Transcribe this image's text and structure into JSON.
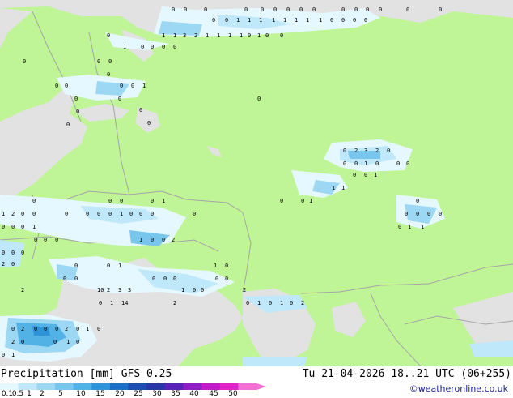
{
  "footer": {
    "title": "Precipitation [mm]",
    "model": "GFS 0.25",
    "valid_time": "Tu 21-04-2026 18..21 UTC (06+255)",
    "credit": "©weatheronline.co.uk"
  },
  "legend": {
    "labels": [
      "0.1",
      "0.5",
      "1",
      "2",
      "5",
      "10",
      "15",
      "20",
      "25",
      "30",
      "35",
      "40",
      "45",
      "50"
    ],
    "colors": [
      "#e6f8ff",
      "#bfe8fa",
      "#9cd8f4",
      "#78c6ee",
      "#52b1e5",
      "#2f93d8",
      "#1e6fc6",
      "#1c4eb0",
      "#2a35a6",
      "#5a23b8",
      "#8d1ec4",
      "#c01cc8",
      "#e024c6",
      "#f070d4"
    ]
  },
  "map": {
    "colors": {
      "land": "#bff596",
      "sea": "#e2e2e2",
      "border": "#a5a5a5"
    },
    "values": [
      "0",
      "0",
      "0",
      "0",
      "0",
      "0",
      "0",
      "0",
      "0",
      "0",
      "0",
      "0",
      "0",
      "0",
      "0",
      "0",
      "0",
      "1",
      "1",
      "1",
      "1",
      "1",
      "1",
      "1",
      "1",
      "0",
      "0",
      "0",
      "0",
      "1",
      "1",
      "3",
      "2",
      "1",
      "1",
      "1",
      "1",
      "0",
      "1",
      "0",
      "0",
      "0",
      "1",
      "0",
      "0",
      "0",
      "0",
      "0",
      "0",
      "0",
      "0",
      "0",
      "0",
      "0",
      "0",
      "1",
      "0",
      "0",
      "0",
      "0",
      "0",
      "0",
      "0",
      "0",
      "2",
      "3",
      "2",
      "0",
      "0",
      "0",
      "1",
      "0",
      "0",
      "0",
      "0",
      "0",
      "1",
      "1",
      "1",
      "0",
      "0",
      "1",
      "0",
      "0",
      "0",
      "0",
      "1",
      "0",
      "0",
      "0",
      "0",
      "0",
      "1",
      "2",
      "0",
      "0",
      "0",
      "0",
      "0",
      "0",
      "1",
      "0",
      "0",
      "0",
      "0",
      "0",
      "1",
      "1",
      "0",
      "0",
      "0",
      "1",
      "0",
      "0",
      "0",
      "1",
      "0",
      "0",
      "2",
      "0",
      "0",
      "0",
      "2",
      "0",
      "0",
      "0",
      "1",
      "1",
      "0",
      "0",
      "0",
      "0",
      "0",
      "0",
      "0",
      "0",
      "2",
      "10",
      "2",
      "3",
      "3",
      "1",
      "0",
      "0",
      "2",
      "0",
      "1",
      "14",
      "2",
      "0",
      "1",
      "0",
      "1",
      "0",
      "2",
      "0",
      "2",
      "0",
      "0",
      "0",
      "2",
      "0",
      "1",
      "0",
      "2",
      "0",
      "0",
      "1",
      "0",
      "0",
      "1"
    ]
  }
}
